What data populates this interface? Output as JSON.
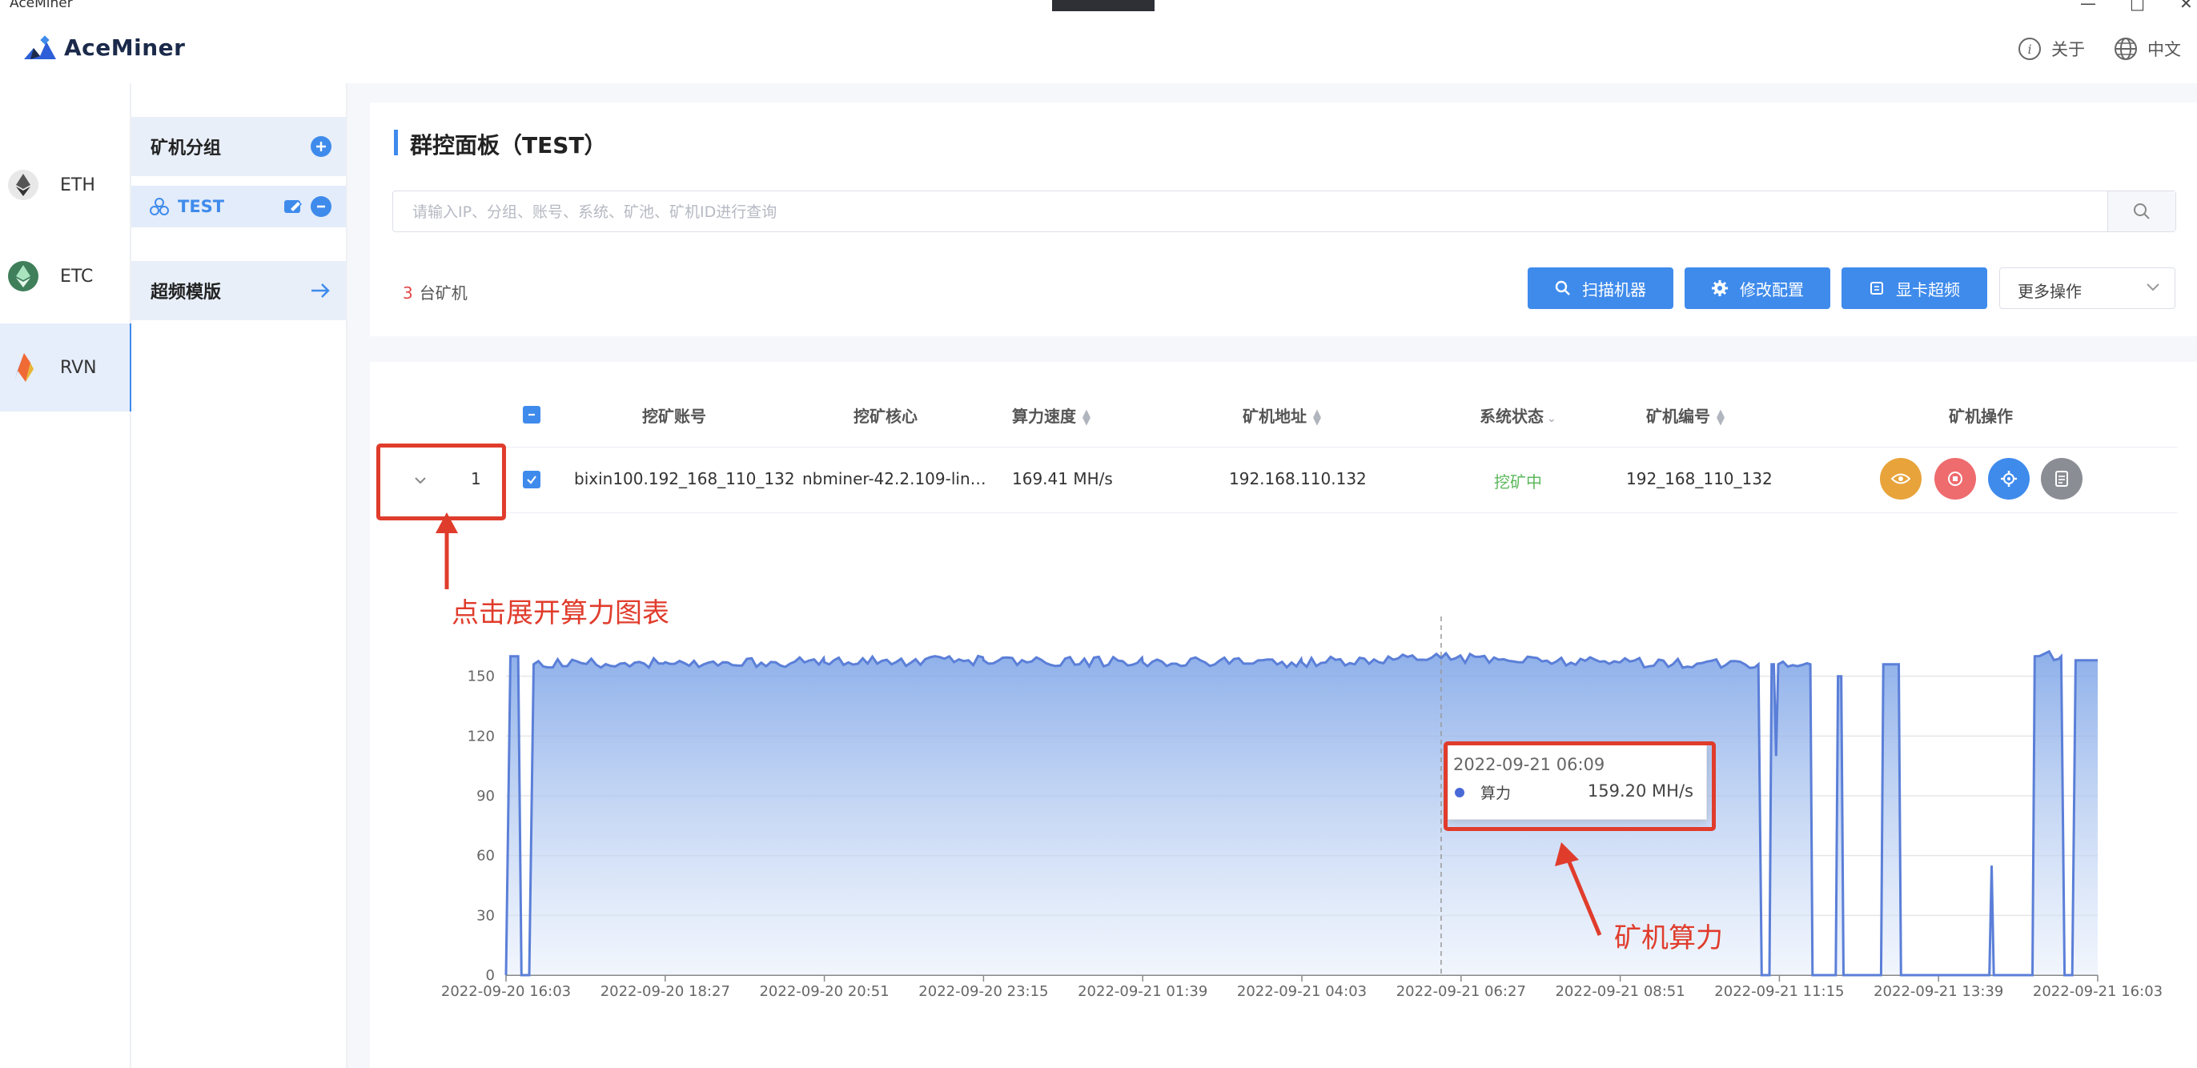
{
  "window": {
    "title": "AceMiner",
    "minimize": "—",
    "maximize": "□",
    "close": "✕"
  },
  "header": {
    "brand": "AceMiner",
    "about": "关于",
    "language": "中文"
  },
  "coins": [
    {
      "label": "ETH",
      "icon": "ethereum-icon",
      "active": false
    },
    {
      "label": "ETC",
      "icon": "ethereum-classic-icon",
      "active": false
    },
    {
      "label": "RVN",
      "icon": "ravencoin-icon",
      "active": true
    }
  ],
  "groups": {
    "title": "矿机分组",
    "items": [
      {
        "label": "TEST"
      }
    ],
    "overclock_template": "超频模版"
  },
  "panel": {
    "title": "群控面板（TEST）",
    "search_placeholder": "请输入IP、分组、账号、系统、矿池、矿机ID进行查询",
    "miner_count": "3",
    "miner_count_suffix": "台矿机",
    "buttons": {
      "scan": "扫描机器",
      "config": "修改配置",
      "overclock": "显卡超频"
    },
    "more_actions": "更多操作"
  },
  "table": {
    "headers": {
      "account": "挖矿账号",
      "core": "挖矿核心",
      "hashrate": "算力速度",
      "address": "矿机地址",
      "status": "系统状态",
      "id": "矿机编号",
      "ops": "矿机操作"
    },
    "rows": [
      {
        "index": "1",
        "account": "bixin100.192_168_110_132",
        "core": "nbminer-42.2.109-lin…",
        "hashrate": "169.41 MH/s",
        "address": "192.168.110.132",
        "status": "挖矿中",
        "id": "192_168_110_132"
      }
    ],
    "op_icons": [
      "eye-icon",
      "stop-icon",
      "gear-icon",
      "log-icon"
    ],
    "op_colors": [
      "#e8a33a",
      "#ee6b6e",
      "#3f8bec",
      "#8a8d93"
    ]
  },
  "annotations": {
    "expand_hint": "点击展开算力图表",
    "hashrate_hint": "矿机算力"
  },
  "chart_data": {
    "type": "area",
    "series": [
      {
        "name": "算力"
      }
    ],
    "y_ticks": [
      0,
      30,
      60,
      90,
      120,
      150
    ],
    "ylim": [
      0,
      180
    ],
    "x_ticks": [
      "2022-09-20 16:03",
      "2022-09-20 18:27",
      "2022-09-20 20:51",
      "2022-09-20 23:15",
      "2022-09-21 01:39",
      "2022-09-21 04:03",
      "2022-09-21 06:27",
      "2022-09-21 08:51",
      "2022-09-21 11:15",
      "2022-09-21 13:39",
      "2022-09-21 16:03"
    ],
    "points": [
      [
        "2022-09-20 16:03",
        0
      ],
      [
        "2022-09-20 16:07",
        160
      ],
      [
        "2022-09-20 16:14",
        160
      ],
      [
        "2022-09-20 16:17",
        0
      ],
      [
        "2022-09-20 16:24",
        0
      ],
      [
        "2022-09-20 16:28",
        156
      ],
      [
        "2022-09-20 18:27",
        157
      ],
      [
        "2022-09-20 20:51",
        157
      ],
      [
        "2022-09-20 23:15",
        158
      ],
      [
        "2022-09-21 01:39",
        157
      ],
      [
        "2022-09-21 04:03",
        157
      ],
      [
        "2022-09-21 06:09",
        159.2
      ],
      [
        "2022-09-21 08:51",
        157
      ],
      [
        "2022-09-21 10:56",
        156
      ],
      [
        "2022-09-21 10:59",
        0
      ],
      [
        "2022-09-21 11:06",
        0
      ],
      [
        "2022-09-21 11:08",
        156
      ],
      [
        "2022-09-21 11:10",
        156
      ],
      [
        "2022-09-21 11:12",
        110
      ],
      [
        "2022-09-21 11:14",
        156
      ],
      [
        "2022-09-21 11:43",
        156
      ],
      [
        "2022-09-21 11:45",
        0
      ],
      [
        "2022-09-21 12:06",
        0
      ],
      [
        "2022-09-21 12:08",
        150
      ],
      [
        "2022-09-21 12:11",
        150
      ],
      [
        "2022-09-21 12:13",
        0
      ],
      [
        "2022-09-21 12:47",
        0
      ],
      [
        "2022-09-21 12:49",
        156
      ],
      [
        "2022-09-21 13:03",
        156
      ],
      [
        "2022-09-21 13:05",
        0
      ],
      [
        "2022-09-21 14:25",
        0
      ],
      [
        "2022-09-21 14:27",
        55
      ],
      [
        "2022-09-21 14:29",
        0
      ],
      [
        "2022-09-21 15:04",
        0
      ],
      [
        "2022-09-21 15:06",
        160
      ],
      [
        "2022-09-21 15:30",
        160
      ],
      [
        "2022-09-21 15:33",
        0
      ],
      [
        "2022-09-21 15:40",
        0
      ],
      [
        "2022-09-21 15:43",
        158
      ],
      [
        "2022-09-21 16:03",
        158
      ]
    ],
    "tooltip": {
      "time": "2022-09-21 06:09",
      "series": "算力",
      "value": "159.20 MH/s"
    }
  }
}
